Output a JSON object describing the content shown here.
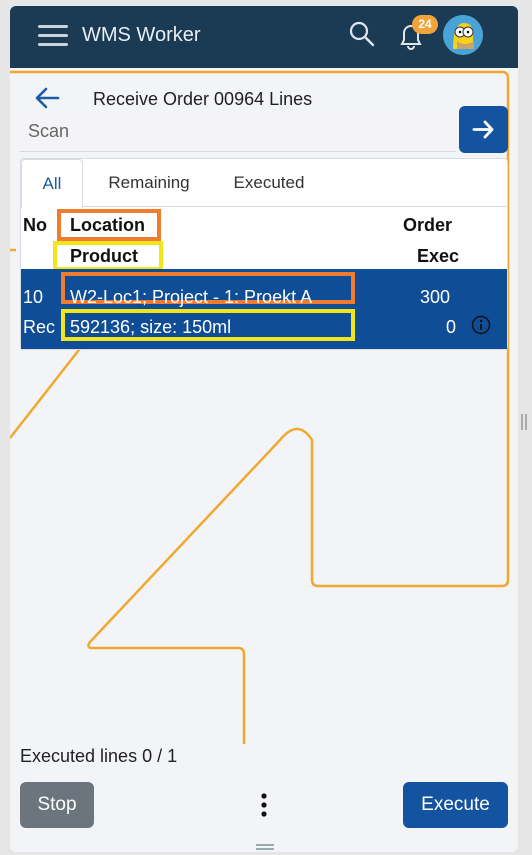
{
  "app": {
    "title": "WMS Worker",
    "notification_count": "24"
  },
  "page": {
    "title": "Receive Order 00964 Lines",
    "back_icon": "arrow-left-icon"
  },
  "scan": {
    "placeholder": "Scan",
    "value": ""
  },
  "tabs": [
    {
      "label": "All",
      "active": true
    },
    {
      "label": "Remaining",
      "active": false
    },
    {
      "label": "Executed",
      "active": false
    }
  ],
  "table": {
    "headers": {
      "no": "No",
      "location": "Location",
      "product": "Product",
      "order": "Order",
      "exec": "Exec"
    },
    "rows": [
      {
        "no": "10",
        "type": "Rec",
        "location": "W2-Loc1; Project - 1: Proekt A",
        "product": "592136; size: 150ml",
        "order": "300",
        "exec": "0"
      }
    ]
  },
  "footer": {
    "executed_lines": "Executed lines 0 / 1",
    "stop_label": "Stop",
    "execute_label": "Execute"
  },
  "colors": {
    "topbar": "#1b3a53",
    "primary": "#1453a0",
    "selected_row": "#0f4d96",
    "highlight_orange": "#ef7c30",
    "highlight_yellow": "#f3e51c",
    "path_line": "#f0a830"
  }
}
